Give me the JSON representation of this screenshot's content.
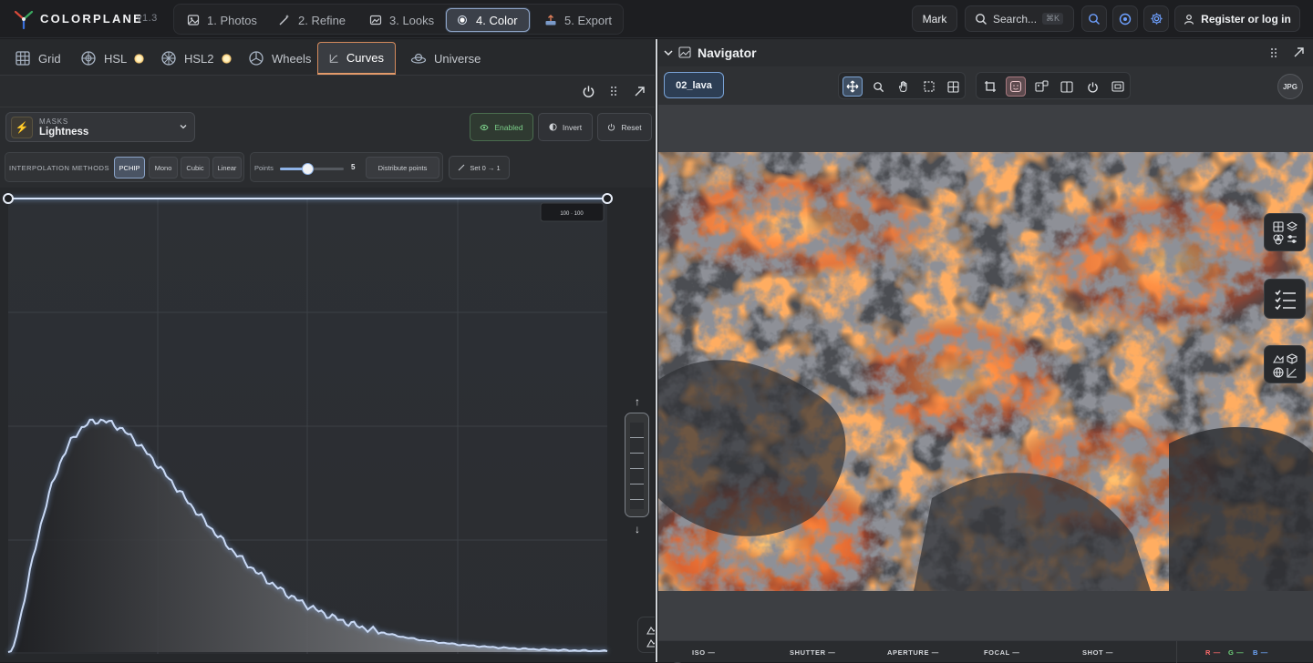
{
  "app": {
    "name": "COLORPLANE",
    "version": "v1.3"
  },
  "steps": [
    {
      "label": "1. Photos",
      "icon": "photo-icon"
    },
    {
      "label": "2. Refine",
      "icon": "magic-wand-icon"
    },
    {
      "label": "3. Looks",
      "icon": "looks-icon"
    },
    {
      "label": "4. Color",
      "icon": "color-dot-icon",
      "active": true
    },
    {
      "label": "5. Export",
      "icon": "export-icon"
    }
  ],
  "header": {
    "mark_label": "Mark",
    "search_placeholder": "Search...",
    "search_shortcut": "⌘K",
    "register_label": "Register or log in"
  },
  "tabs": [
    {
      "label": "Grid",
      "icon": "grid-icon"
    },
    {
      "label": "HSL",
      "icon": "hsl-wheel-icon",
      "indicator": true
    },
    {
      "label": "HSL2",
      "icon": "snowflake-wheel-icon",
      "indicator": true
    },
    {
      "label": "Wheels",
      "icon": "wheels-icon"
    },
    {
      "label": "Curves",
      "icon": "curves-icon",
      "active": true
    },
    {
      "label": "Universe",
      "icon": "universe-icon"
    }
  ],
  "masks": {
    "label": "MASKS",
    "value": "Lightness"
  },
  "mask_buttons": {
    "enabled": "Enabled",
    "invert": "Invert",
    "reset": "Reset"
  },
  "interpolation": {
    "label": "INTERPOLATION METHODS",
    "methods": [
      "PCHIP",
      "Mono",
      "Cubic",
      "Linear"
    ],
    "selected": "PCHIP"
  },
  "points": {
    "label": "Points",
    "value": "5",
    "slider_fraction": 0.43,
    "distribute_label": "Distribute points",
    "set_label": "Set 0 → 1"
  },
  "curve": {
    "readout": "100 · 100"
  },
  "navigator": {
    "title": "Navigator",
    "file_chip": "02_lava",
    "format_badge": "JPG"
  },
  "status": {
    "iso": "ISO —",
    "shutter": "SHUTTER —",
    "aperture": "APERTURE —",
    "focal": "FOCAL —",
    "shot": "SHOT —",
    "r": "R —",
    "g": "G —",
    "b": "B —",
    "colors": {
      "r": "#ff6b6b",
      "g": "#6fd17a",
      "b": "#6fa8ff"
    }
  },
  "colors": {
    "accent": "#8ea4c6",
    "tab_accent": "#e39a6a",
    "enabled_green": "#7cd08a"
  }
}
